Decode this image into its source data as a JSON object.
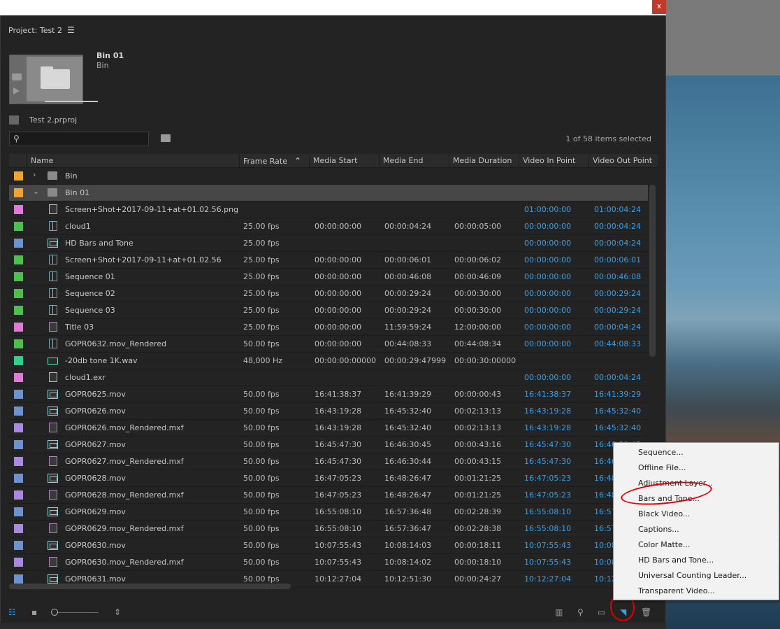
{
  "window": {
    "close_label": "x"
  },
  "panel": {
    "tab_title": "Project: Test 2",
    "bin": {
      "name": "Bin 01",
      "type": "Bin"
    },
    "project_file": "Test 2.prproj",
    "search": {
      "placeholder": "",
      "value": ""
    },
    "items_selected": "1 of 58 items selected"
  },
  "columns": [
    "Name",
    "Frame Rate",
    "Media Start",
    "Media End",
    "Media Duration",
    "Video In Point",
    "Video Out Point"
  ],
  "rows": [
    {
      "color": "#f0a330",
      "icon": "bin-icon",
      "twisty": "expand",
      "name": "Bin",
      "rate": "",
      "start": "",
      "end": "",
      "dur": "",
      "vin": "",
      "vout": ""
    },
    {
      "color": "#f0a330",
      "icon": "bin-icon",
      "twisty": "collapse",
      "name": "Bin 01",
      "rate": "",
      "start": "",
      "end": "",
      "dur": "",
      "vin": "",
      "vout": "",
      "selected": true
    },
    {
      "color": "#e07ad8",
      "icon": "still-image-icon",
      "name": "Screen+Shot+2017-09-11+at+01.02.56.png",
      "rate": "",
      "start": "",
      "end": "",
      "dur": "",
      "vin": "01:00:00:00",
      "vout": "01:00:04:24"
    },
    {
      "color": "#4cbf4c",
      "icon": "sequence-icon",
      "name": "cloud1",
      "rate": "25.00 fps",
      "start": "00:00:00:00",
      "end": "00:00:04:24",
      "dur": "00:00:05:00",
      "vin": "00:00:00:00",
      "vout": "00:00:04:24"
    },
    {
      "color": "#6a93d0",
      "icon": "clip-icon",
      "name": "HD Bars and Tone",
      "rate": "25.00 fps",
      "start": "",
      "end": "",
      "dur": "",
      "vin": "00:00:00:00",
      "vout": "00:00:04:24"
    },
    {
      "color": "#4cbf4c",
      "icon": "sequence-icon",
      "name": "Screen+Shot+2017-09-11+at+01.02.56",
      "rate": "25.00 fps",
      "start": "00:00:00:00",
      "end": "00:00:06:01",
      "dur": "00:00:06:02",
      "vin": "00:00:00:00",
      "vout": "00:00:06:01"
    },
    {
      "color": "#4cbf4c",
      "icon": "sequence-icon",
      "name": "Sequence 01",
      "rate": "25.00 fps",
      "start": "00:00:00:00",
      "end": "00:00:46:08",
      "dur": "00:00:46:09",
      "vin": "00:00:00:00",
      "vout": "00:00:46:08"
    },
    {
      "color": "#4cbf4c",
      "icon": "sequence-icon",
      "name": "Sequence 02",
      "rate": "25.00 fps",
      "start": "00:00:00:00",
      "end": "00:00:29:24",
      "dur": "00:00:30:00",
      "vin": "00:00:00:00",
      "vout": "00:00:29:24"
    },
    {
      "color": "#4cbf4c",
      "icon": "sequence-icon",
      "name": "Sequence 03",
      "rate": "25.00 fps",
      "start": "00:00:00:00",
      "end": "00:00:29:24",
      "dur": "00:00:30:00",
      "vin": "00:00:00:00",
      "vout": "00:00:29:24"
    },
    {
      "color": "#e07ad8",
      "icon": "title-icon",
      "name": "Title 03",
      "rate": "25.00 fps",
      "start": "00:00:00:00",
      "end": "11:59:59:24",
      "dur": "12:00:00:00",
      "vin": "00:00:00:00",
      "vout": "00:00:04:24"
    },
    {
      "color": "#4cbf4c",
      "icon": "sequence-icon",
      "name": "GOPR0632.mov_Rendered",
      "rate": "50.00 fps",
      "start": "00:00:00:00",
      "end": "00:44:08:33",
      "dur": "00:44:08:34",
      "vin": "00:00:00:00",
      "vout": "00:44:08:33"
    },
    {
      "color": "#2fd08a",
      "icon": "audio-icon",
      "name": "-20db tone 1K.wav",
      "rate": "48,000 Hz",
      "start": "00:00:00:00000",
      "end": "00:00:29:47999",
      "dur": "00:00:30:00000",
      "vin": "",
      "vout": ""
    },
    {
      "color": "#e07ad8",
      "icon": "still-image-icon",
      "name": "cloud1.exr",
      "rate": "",
      "start": "",
      "end": "",
      "dur": "",
      "vin": "00:00:00:00",
      "vout": "00:00:04:24"
    },
    {
      "color": "#6a93d0",
      "icon": "clip-icon",
      "name": "GOPR0625.mov",
      "rate": "50.00 fps",
      "start": "16:41:38:37",
      "end": "16:41:39:29",
      "dur": "00:00:00:43",
      "vin": "16:41:38:37",
      "vout": "16:41:39:29"
    },
    {
      "color": "#6a93d0",
      "icon": "clip-icon",
      "name": "GOPR0626.mov",
      "rate": "50.00 fps",
      "start": "16:43:19:28",
      "end": "16:45:32:40",
      "dur": "00:02:13:13",
      "vin": "16:43:19:28",
      "vout": "16:45:32:40"
    },
    {
      "color": "#a98ae0",
      "icon": "mxf-icon",
      "name": "GOPR0626.mov_Rendered.mxf",
      "rate": "50.00 fps",
      "start": "16:43:19:28",
      "end": "16:45:32:40",
      "dur": "00:02:13:13",
      "vin": "16:43:19:28",
      "vout": "16:45:32:40"
    },
    {
      "color": "#6a93d0",
      "icon": "clip-icon",
      "name": "GOPR0627.mov",
      "rate": "50.00 fps",
      "start": "16:45:47:30",
      "end": "16:46:30:45",
      "dur": "00:00:43:16",
      "vin": "16:45:47:30",
      "vout": "16:46:30:45"
    },
    {
      "color": "#a98ae0",
      "icon": "mxf-icon",
      "name": "GOPR0627.mov_Rendered.mxf",
      "rate": "50.00 fps",
      "start": "16:45:47:30",
      "end": "16:46:30:44",
      "dur": "00:00:43:15",
      "vin": "16:45:47:30",
      "vout": "16:46"
    },
    {
      "color": "#6a93d0",
      "icon": "clip-icon",
      "name": "GOPR0628.mov",
      "rate": "50.00 fps",
      "start": "16:47:05:23",
      "end": "16:48:26:47",
      "dur": "00:01:21:25",
      "vin": "16:47:05:23",
      "vout": "16:48"
    },
    {
      "color": "#a98ae0",
      "icon": "mxf-icon",
      "name": "GOPR0628.mov_Rendered.mxf",
      "rate": "50.00 fps",
      "start": "16:47:05:23",
      "end": "16:48:26:47",
      "dur": "00:01:21:25",
      "vin": "16:47:05:23",
      "vout": "16:48"
    },
    {
      "color": "#6a93d0",
      "icon": "clip-icon",
      "name": "GOPR0629.mov",
      "rate": "50.00 fps",
      "start": "16:55:08:10",
      "end": "16:57:36:48",
      "dur": "00:02:28:39",
      "vin": "16:55:08:10",
      "vout": "16:57"
    },
    {
      "color": "#a98ae0",
      "icon": "mxf-icon",
      "name": "GOPR0629.mov_Rendered.mxf",
      "rate": "50.00 fps",
      "start": "16:55:08:10",
      "end": "16:57:36:47",
      "dur": "00:02:28:38",
      "vin": "16:55:08:10",
      "vout": "16:57"
    },
    {
      "color": "#6a93d0",
      "icon": "clip-icon",
      "name": "GOPR0630.mov",
      "rate": "50.00 fps",
      "start": "10:07:55:43",
      "end": "10:08:14:03",
      "dur": "00:00:18:11",
      "vin": "10:07:55:43",
      "vout": "10:08"
    },
    {
      "color": "#a98ae0",
      "icon": "mxf-icon",
      "name": "GOPR0630.mov_Rendered.mxf",
      "rate": "50.00 fps",
      "start": "10:07:55:43",
      "end": "10:08:14:02",
      "dur": "00:00:18:10",
      "vin": "10:07:55:43",
      "vout": "10:08"
    },
    {
      "color": "#6a93d0",
      "icon": "clip-icon",
      "name": "GOPR0631.mov",
      "rate": "50.00 fps",
      "start": "10:12:27:04",
      "end": "10:12:51:30",
      "dur": "00:00:24:27",
      "vin": "10:12:27:04",
      "vout": "10:12"
    }
  ],
  "context_menu": [
    "Sequence...",
    "Offline File...",
    "Adjustment Layer...",
    "Bars and Tone...",
    "Black Video...",
    "Captions...",
    "Color Matte...",
    "HD Bars and Tone...",
    "Universal Counting Leader...",
    "Transparent Video..."
  ],
  "bottom_icons": {
    "list_view": "list-view-icon",
    "icon_view": "icon-view-icon",
    "sort": "sort-icons-icon",
    "automate": "automate-to-sequence-icon",
    "find": "find-icon",
    "new_bin": "new-bin-icon",
    "new_item": "new-item-icon",
    "clear": "clear-icon"
  },
  "colors": {
    "accent": "#3aa0e8",
    "annotation": "#e00000"
  }
}
